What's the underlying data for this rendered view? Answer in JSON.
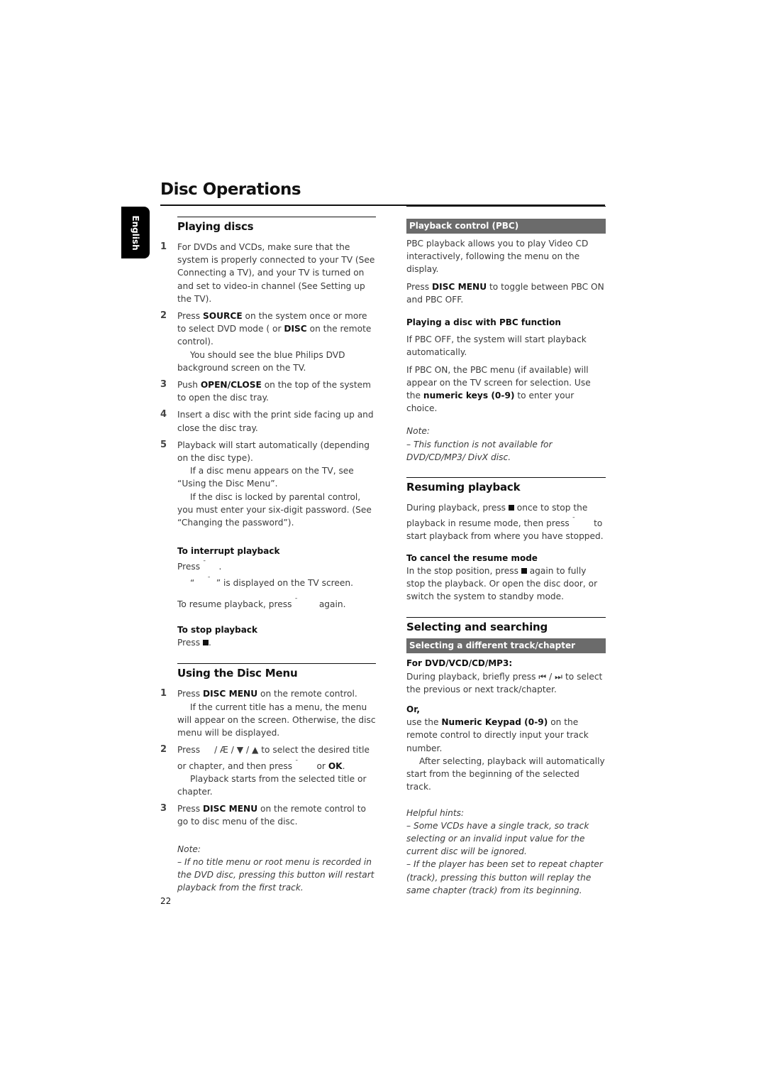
{
  "page": {
    "title": "Disc Operations",
    "language_tab": "English",
    "page_number": "22"
  },
  "left": {
    "playing_discs": {
      "heading": "Playing discs",
      "steps": [
        {
          "num": "1",
          "text": "For DVDs and VCDs, make sure that the system is properly connected to your TV (See Connecting a TV), and your TV is turned on and set to video-in channel (See Setting up the TV)."
        },
        {
          "num": "2",
          "pre": "Press ",
          "b1": "SOURCE",
          "mid": " on the system once or more to select DVD mode ( or ",
          "b2": "DISC",
          "post": " on the remote control).",
          "note": "You should see the blue Philips DVD background screen on the TV."
        },
        {
          "num": "3",
          "pre": "Push ",
          "b1": "OPEN/CLOSE",
          "post": " on the top of the system to open the disc tray."
        },
        {
          "num": "4",
          "text": "Insert a disc with the print side facing up and close the disc tray."
        },
        {
          "num": "5",
          "text": "Playback will start automatically (depending on the disc type).",
          "note1": "If a disc menu appears on the TV, see “Using the Disc Menu”.",
          "note2": "If the disc is locked by parental control, you must enter your six-digit password. (See “Changing the password”)."
        }
      ],
      "interrupt": {
        "heading": "To interrupt playback",
        "line1": "Press",
        "line1_end": ".",
        "line2_pre": "“",
        "line2_post": "” is displayed on the TV screen.",
        "line3_pre": "To resume playback, press",
        "line3_post": "again."
      },
      "stop": {
        "heading": "To stop playback",
        "text_pre": "Press",
        "text_post": "."
      }
    },
    "disc_menu": {
      "heading": "Using the Disc Menu",
      "step1": {
        "num": "1",
        "pre": "Press ",
        "b": "DISC MENU",
        "post": " on the remote control.",
        "note": "If the current title has a menu, the menu will appear on the screen.  Otherwise, the disc menu will be displayed."
      },
      "step2": {
        "num": "2",
        "pre": "Press",
        "keys": "/ Æ / ▼ / ▲",
        "mid": "to select the desired title or chapter, and then press",
        "or": "or",
        "b": "OK",
        "end": ".",
        "note": "Playback starts from the selected title or chapter."
      },
      "step3": {
        "num": "3",
        "pre": "Press ",
        "b": "DISC MENU",
        "post": " on the remote control to go to disc menu of the disc."
      },
      "note_label": "Note:",
      "note_text": "–  If no title menu or root menu is recorded in the DVD disc, pressing this button will restart playback from the first track."
    }
  },
  "right": {
    "pbc": {
      "bar": "Playback  control (PBC)",
      "p1": "PBC playback allows you to play Video CD interactively, following the menu on the display.",
      "p2_pre": "Press ",
      "p2_b": "DISC MENU",
      "p2_post": " to toggle between PBC ON and PBC OFF.",
      "sub_heading": "Playing a disc with PBC function",
      "p3": "If PBC OFF, the system will start playback automatically.",
      "p4_pre": "If PBC ON, the PBC menu (if available) will appear on the TV screen for selection. Use the ",
      "p4_b": "numeric keys (0-9)",
      "p4_post": " to enter your choice.",
      "note_label": "Note:",
      "note_text": "–  This function is not available for DVD/CD/MP3/ DivX disc."
    },
    "resume": {
      "heading": "Resuming playback",
      "p1_pre": "During playback, press",
      "p1_mid": "once to stop the playback in resume mode, then press",
      "p1_post": "to start playback from where you have stopped.",
      "sub_heading": "To cancel the resume mode",
      "p2_pre": "In the stop position, press",
      "p2_post": "again to fully stop the playback. Or open the disc door, or switch the system to standby mode."
    },
    "select": {
      "heading": "Selecting and searching",
      "bar": "Selecting a different track/chapter",
      "sub_heading": "For DVD/VCD/CD/MP3:",
      "p1_pre": "During playback, briefly press",
      "p1_keys": "⏮ / ⏭",
      "p1_post": "to select the previous or next track/chapter.",
      "or": "Or,",
      "p2_pre": "use the ",
      "p2_b": "Numeric Keypad (0-9)",
      "p2_post": " on the remote control to directly input your track number.",
      "p3": "After selecting, playback will automatically start from the beginning of the selected track.",
      "hints_label": "Helpful hints:",
      "hint1": " –  Some VCDs have a single track,  so track selecting or an invalid input value for the current disc will be ignored.",
      "hint2": "–   If the player has been set to repeat chapter (track), pressing this button will replay the same chapter (track) from its beginning."
    }
  }
}
